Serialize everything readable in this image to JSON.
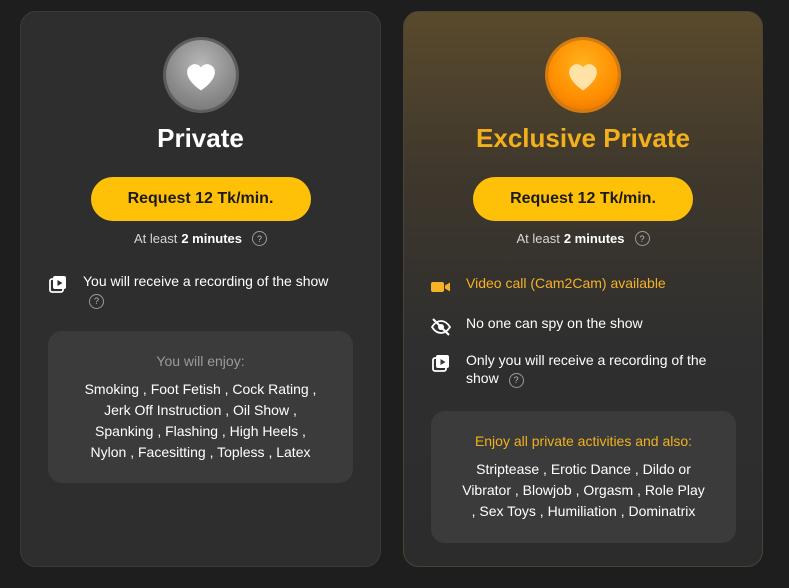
{
  "private": {
    "title": "Private",
    "request_label": "Request 12 Tk/min.",
    "duration_prefix": "At least",
    "duration_value": "2 minutes",
    "help_glyph": "?",
    "features": [
      {
        "text": "You will receive a recording of the show",
        "icon": "recording-icon"
      }
    ],
    "enjoy_title": "You will enjoy:",
    "enjoy_lines": [
      "Smoking , Foot Fetish , Cock Rating ,",
      "Jerk Off Instruction , Oil Show ,",
      "Spanking , Flashing , High Heels ,",
      "Nylon , Facesitting , Topless , Latex"
    ]
  },
  "exclusive": {
    "title": "Exclusive Private",
    "request_label": "Request 12 Tk/min.",
    "duration_prefix": "At least",
    "duration_value": "2 minutes",
    "help_glyph": "?",
    "features": [
      {
        "text": "Video call (Cam2Cam) available",
        "icon": "video-camera-icon"
      },
      {
        "text": "No one can spy on the show",
        "icon": "eye-off-icon"
      },
      {
        "text": "Only you will receive a recording of the show",
        "icon": "recording-icon"
      }
    ],
    "enjoy_title": "Enjoy all private activities and also:",
    "enjoy_lines": [
      "Striptease , Erotic Dance , Dildo or",
      "Vibrator , Blowjob , Orgasm , Role Play",
      ", Sex Toys , Humiliation , Dominatrix"
    ]
  },
  "colors": {
    "accent": "#ffc107",
    "exclusive_title": "#f2b11c",
    "card_bg": "#2e2e2e",
    "page_bg": "#1e1e1e"
  }
}
